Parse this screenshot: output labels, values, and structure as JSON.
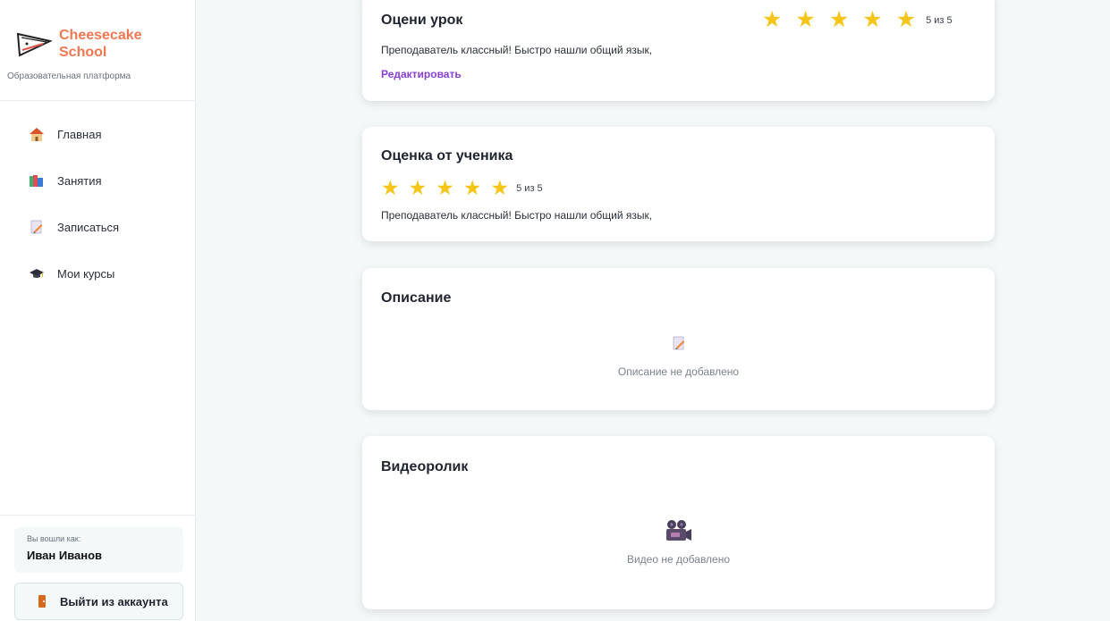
{
  "sidebar": {
    "brand_name": "Cheesecake School",
    "brand_subtitle": "Образовательная платформа",
    "items": [
      {
        "label": "Главная",
        "icon": "house-icon"
      },
      {
        "label": "Занятия",
        "icon": "books-icon"
      },
      {
        "label": "Записаться",
        "icon": "memo-icon"
      },
      {
        "label": "Мои курсы",
        "icon": "graduation-cap-icon"
      }
    ],
    "user_label": "Вы вошли как:",
    "user_name": "Иван Иванов",
    "logout_label": "Выйти из аккаунта"
  },
  "rate_lesson": {
    "title": "Оцени урок",
    "rating": 5,
    "rating_text": "5 из 5",
    "review": "Преподаватель классный! Быстро нашли общий язык,",
    "edit_label": "Редактировать"
  },
  "student_rating": {
    "title": "Оценка от ученика",
    "rating": 5,
    "rating_text": "5 из 5",
    "review": "Преподаватель классный! Быстро нашли общий язык,"
  },
  "description": {
    "title": "Описание",
    "empty_text": "Описание не добавлено"
  },
  "video": {
    "title": "Видеоролик",
    "empty_text": "Видео не добавлено"
  },
  "colors": {
    "accent": "#f07850",
    "link": "#8b3fd1",
    "star": "#f5c518",
    "background": "#f3f8f8"
  }
}
